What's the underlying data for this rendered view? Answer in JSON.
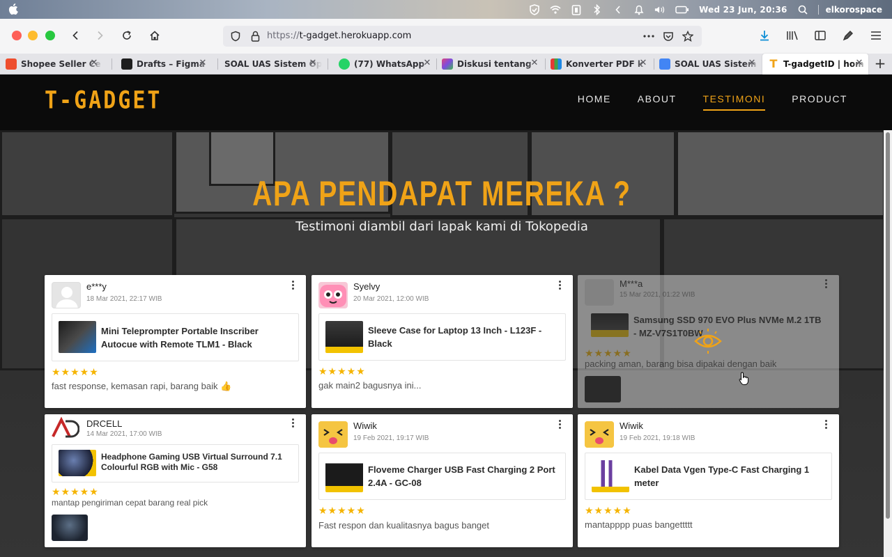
{
  "os": {
    "date": "Wed 23 Jun, 20:36",
    "user": "elkorospace"
  },
  "browser": {
    "url_proto": "https://",
    "url_host": "t-gadget.herokuapp.com",
    "tabs": [
      {
        "label": "Shopee Seller Ce",
        "color": "#ee4d2d"
      },
      {
        "label": "Drafts – Figma",
        "color": "#1e1e1e"
      },
      {
        "label": "SOAL UAS Sistem Op",
        "color": "#e4e4e8"
      },
      {
        "label": "(77) WhatsApp",
        "color": "#25d366"
      },
      {
        "label": "Diskusi tentang",
        "color": "#7b4ce0"
      },
      {
        "label": "Konverter PDF k",
        "color": "#e53935"
      },
      {
        "label": "SOAL UAS Sistem",
        "color": "#4285f4"
      },
      {
        "label": "T-gadgetID | hom",
        "color": "#f0a317"
      }
    ]
  },
  "site": {
    "logo": "T-GADGET",
    "nav": [
      "HOME",
      "ABOUT",
      "TESTIMONI",
      "PRODUCT"
    ],
    "hero_title": "APA PENDAPAT MEREKA ?",
    "hero_subtitle": "Testimoni diambil dari lapak kami di Tokopedia"
  },
  "colors": {
    "accent": "#f0a317",
    "star": "#f5b400"
  },
  "testimonials": [
    {
      "name": "e***y",
      "date": "18 Mar 2021, 22:17 WIB",
      "product": "Mini Teleprompter Portable Inscriber Autocue with Remote TLM1 - Black",
      "stars": "★★★★★",
      "review": "fast response, kemasan rapi, barang baik 👍"
    },
    {
      "name": "Syelvy",
      "date": "20 Mar 2021, 12:00 WIB",
      "product": "Sleeve Case for Laptop 13 Inch - L123F - Black",
      "stars": "★★★★★",
      "review": "gak main2 bagusnya ini..."
    },
    {
      "name": "M***a",
      "date": "15 Mar 2021, 01:22 WIB",
      "product": "Samsung SSD 970 EVO Plus NVMe M.2 1TB - MZ-V7S1T0BW",
      "stars": "★★★★★",
      "review": "packing aman, barang bisa dipakai dengan baik"
    },
    {
      "name": "DRCELL",
      "date": "14 Mar 2021, 17:00 WIB",
      "product": "Headphone Gaming USB Virtual Surround 7.1 Colourful RGB with Mic - G58",
      "stars": "★★★★★",
      "review": "mantap pengiriman cepat barang real pick"
    },
    {
      "name": "Wiwik",
      "date": "19 Feb 2021, 19:17 WIB",
      "product": "Floveme Charger USB Fast Charging 2 Port 2.4A - GC-08",
      "stars": "★★★★★",
      "review": "Fast respon dan kualitasnya bagus banget"
    },
    {
      "name": "Wiwik",
      "date": "19 Feb 2021, 19:18 WIB",
      "product": "Kabel Data Vgen Type-C Fast Charging 1 meter",
      "stars": "★★★★★",
      "review": "mantapppp puas bangettttt"
    }
  ]
}
